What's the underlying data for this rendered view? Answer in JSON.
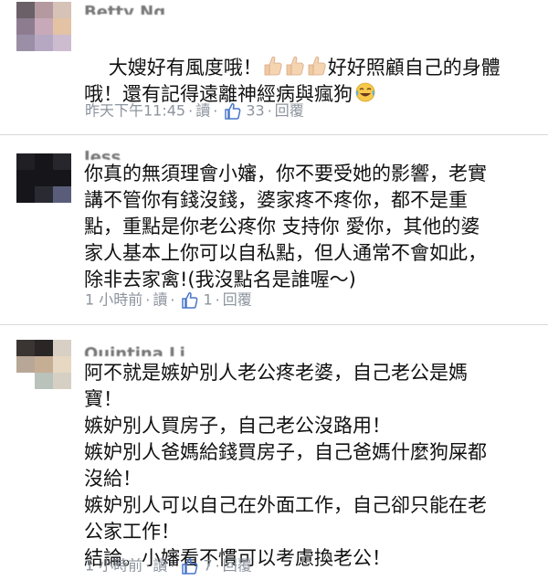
{
  "comments": [
    {
      "author": "Betty Ng",
      "text_before": "大嫂好有風度哦！",
      "emoji_count": 3,
      "text_after": "好好照顧自己的身體\n哦！還有記得遠離神經病與瘋狗",
      "time": "昨天下午11:45",
      "reply_action": "讀",
      "likes": "33",
      "reply_label": "回覆"
    },
    {
      "author": "Jess",
      "text": "你真的無須理會小嬸，你不要受她的影響，老實\n講不管你有錢沒錢，婆家疼不疼你，都不是重\n點，重點是你老公疼你 支持你 愛你，其他的婆\n家人基本上你可以自私點，但人通常不會如此，\n除非去家禽!(我沒點名是誰喔～)",
      "time": "1 小時前",
      "reply_action": "讀",
      "likes": "1",
      "reply_label": "回覆"
    },
    {
      "author": "Quintina Li",
      "text": "阿不就是嫉妒別人老公疼老婆，自己老公是媽\n寶！\n嫉妒別人買房子，自己老公沒路用！\n嫉妒別人爸媽給錢買房子，自己爸媽什麼狗屎都\n沒給！\n嫉妒別人可以自己在外面工作，自己卻只能在老\n公家工作！\n結論。小嬸看不慣可以考慮換老公！",
      "time": "1 小時前",
      "reply_action": "讀",
      "likes": "7",
      "reply_label": "回覆"
    }
  ],
  "colors": {
    "meta": "#8d949e",
    "like_blue": "#4a76c8",
    "divider": "#d8d8d8"
  }
}
